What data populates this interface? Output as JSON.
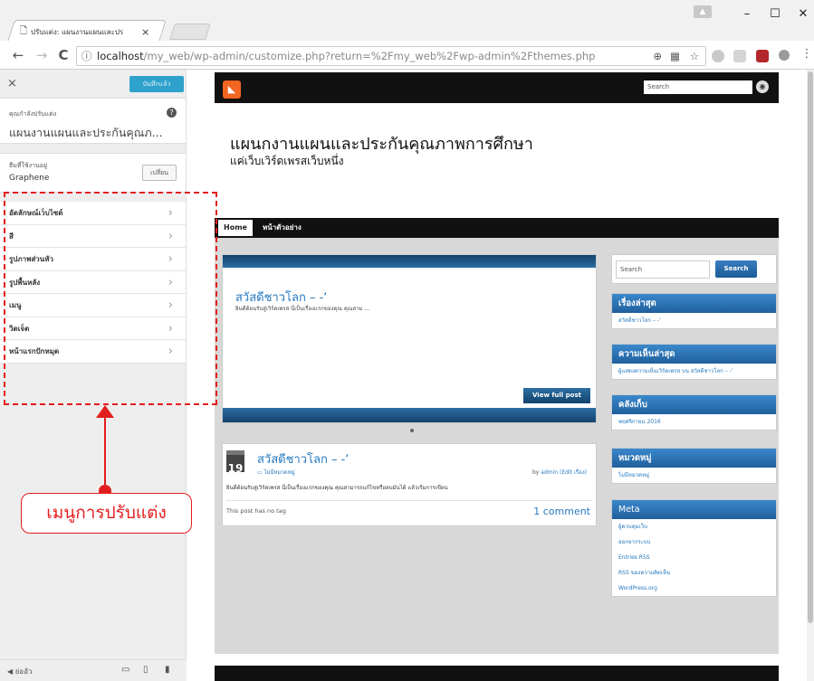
{
  "browser": {
    "tab_title": "ปรับแต่ง: แผนงานแผนและปร",
    "url_host": "localhost",
    "url_path": "/my_web/wp-admin/customize.php?return=%2Fmy_web%2Fwp-admin%2Fthemes.php",
    "back": "←",
    "forward": "→",
    "reload": "C",
    "info": "ⓘ",
    "close": "×",
    "minimize": "–",
    "maximize": "☐",
    "win_close": "✕"
  },
  "customizer": {
    "close": "×",
    "save_label": "บันทึกแล้ว",
    "customizing_label": "คุณกำลังปรับแต่ง",
    "site_name": "แผนงานแผนและประกันคุณภ...",
    "active_theme_label": "ธีมที่ใช้งานอยู่",
    "theme_name": "Graphene",
    "change_label": "เปลี่ยน",
    "menu_items": [
      {
        "label": "อัตลักษณ์เว็บไซต์"
      },
      {
        "label": "สี"
      },
      {
        "label": "รูปภาพส่วนหัว"
      },
      {
        "label": "รูปพื้นหลัง"
      },
      {
        "label": "เมนู"
      },
      {
        "label": "วิดเจ็ต"
      },
      {
        "label": "หน้าแรกปักหมุด"
      }
    ],
    "collapse_label": "ย่ออัว"
  },
  "annotation": {
    "callout_label": "เมนูการปรับแต่ง",
    "accent_color": "#e31e1e"
  },
  "preview": {
    "search_placeholder": "Search",
    "site_title": "แผนกงานแผนและประกันคุณภาพการศึกษา",
    "site_description": "แค่เว็บเวิร์ดเพรสเว็บหนึ่ง",
    "nav": [
      "Home",
      "หน้าตัวอย่าง"
    ],
    "slider": {
      "title": "สวัสดีชาวโลก – -‘",
      "excerpt": "ยินดีต้อนรับสู่เวิร์ดเพรส นี่เป็นเรื่องแรกของคุณ คุณสาม ...",
      "button": "View full post"
    },
    "post": {
      "day": "19",
      "title": "สวัสดีชาวโลก – -‘",
      "category": "ไม่มีหมวดหมู่",
      "by": "by ",
      "author": "admin",
      "edit": " (Edit เรื่อง)",
      "excerpt": "ยินดีต้อนรับสู่เวิร์ดเพรส นี่เป็นเรื่องแรกของคุณ คุณสามารถแก้ไขหรือลบมันได้ แล้วเริ่มการเขียน",
      "tags": "This post has no tag",
      "comments": "1 comment"
    },
    "sidebar": {
      "search_placeholder": "Search",
      "search_button": "Search",
      "recent_posts": {
        "title": "เรื่องล่าสุด",
        "items": [
          "สวัสดีชาวโลก – -‘"
        ]
      },
      "recent_comments": {
        "title": "ความเห็นล่าสุด",
        "items": [
          "ผู้แสดงความเห็นเวิร์ดเพรส บน สวัสดีชาวโลก – -‘"
        ]
      },
      "archives": {
        "title": "คลังเก็บ",
        "items": [
          "พฤศจิกายน 2016"
        ]
      },
      "categories": {
        "title": "หมวดหมู่",
        "items": [
          "ไม่มีหมวดหมู่"
        ]
      },
      "meta": {
        "title": "Meta",
        "items": [
          "ผู้ควบคุมเว็บ",
          "ออกจากระบบ",
          "Entries RSS",
          "RSS ของความคิดเห็น",
          "WordPress.org"
        ]
      }
    }
  }
}
